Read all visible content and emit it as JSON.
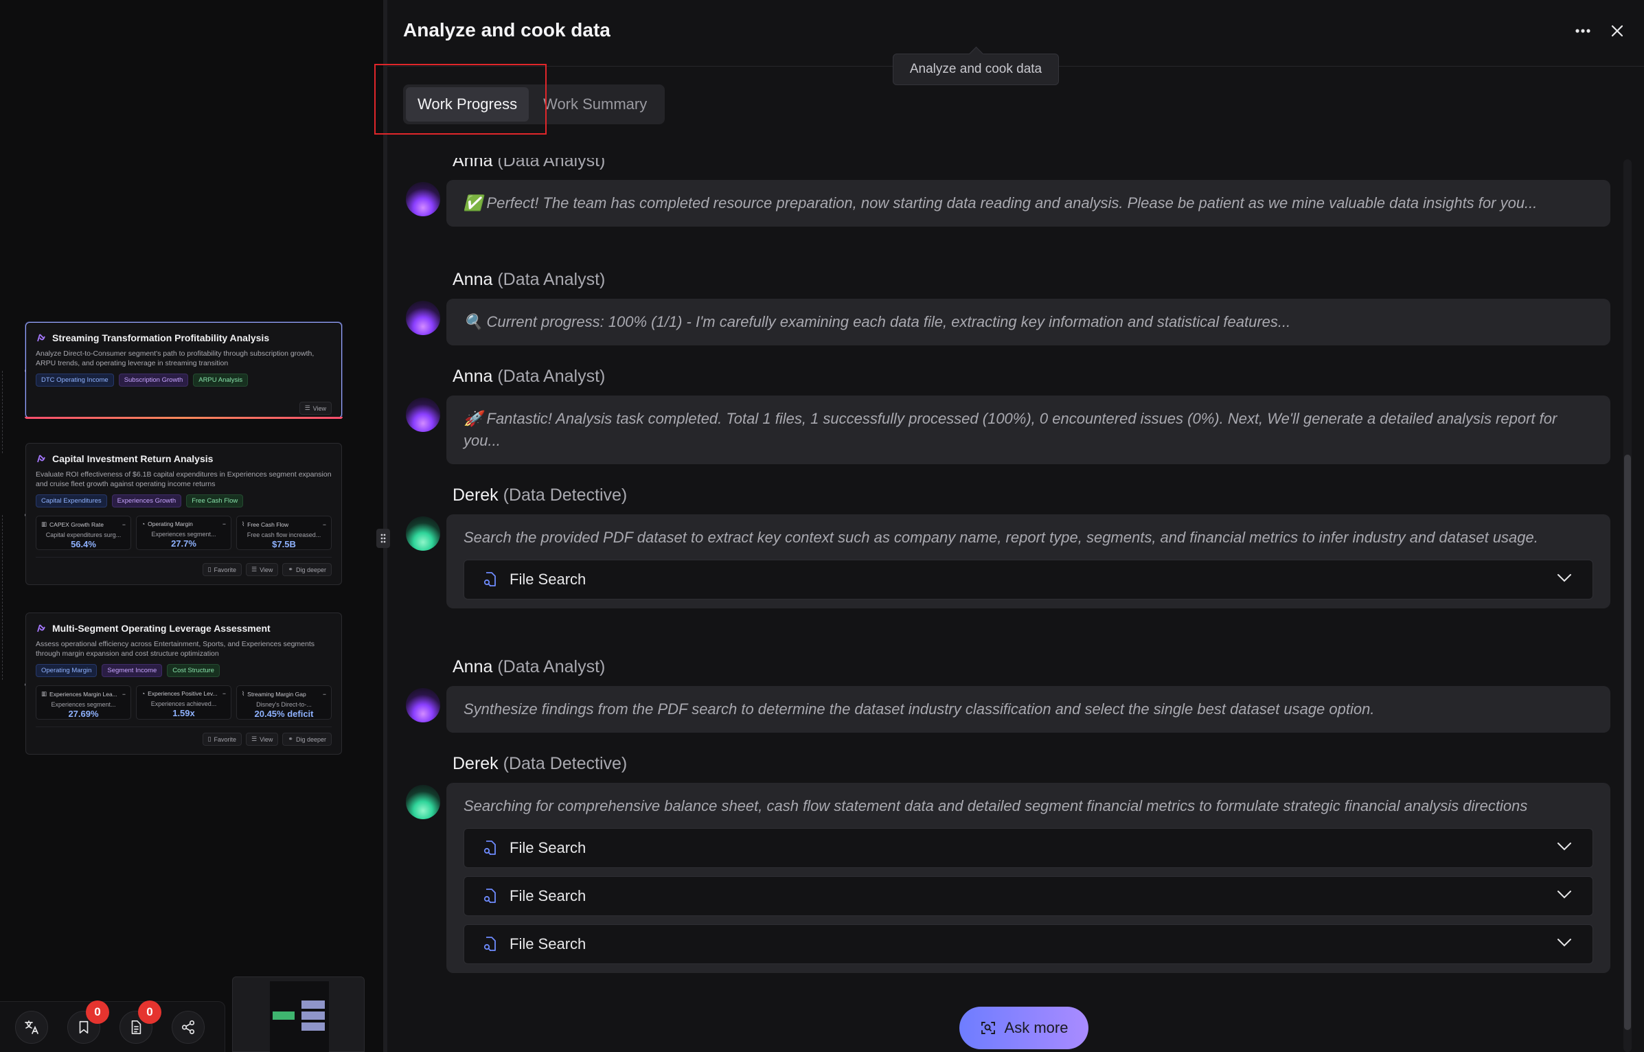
{
  "left_canvas": {
    "cards": [
      {
        "title": "Streaming Transformation Profitability Analysis",
        "desc": "Analyze Direct-to-Consumer segment's path to profitability through subscription growth, ARPU trends, and operating leverage in streaming transition",
        "tags": [
          "DTC Operating Income",
          "Subscription Growth",
          "ARPU Analysis"
        ],
        "actions": [
          "View"
        ]
      },
      {
        "title": "Capital Investment Return Analysis",
        "desc": "Evaluate ROI effectiveness of $6.1B capital expenditures in Experiences segment expansion and cruise fleet growth against operating income returns",
        "tags": [
          "Capital Expenditures",
          "Experiences Growth",
          "Free Cash Flow"
        ],
        "metrics": [
          {
            "name": "CAPEX Growth Rate",
            "sub": "Capital expenditures surg...",
            "value": "56.4%"
          },
          {
            "name": "Operating Margin",
            "sub": "Experiences segment...",
            "value": "27.7%"
          },
          {
            "name": "Free Cash Flow",
            "sub": "Free cash flow increased...",
            "value": "$7.5B"
          }
        ],
        "actions": [
          "Favorite",
          "View",
          "Dig deeper"
        ]
      },
      {
        "title": "Multi-Segment Operating Leverage Assessment",
        "desc": "Assess operational efficiency across Entertainment, Sports, and Experiences segments through margin expansion and cost structure optimization",
        "tags": [
          "Operating Margin",
          "Segment Income",
          "Cost Structure"
        ],
        "metrics": [
          {
            "name": "Experiences Margin Lea...",
            "sub": "Experiences segment...",
            "value": "27.69%"
          },
          {
            "name": "Experiences Positive Lev...",
            "sub": "Experiences achieved...",
            "value": "1.59x"
          },
          {
            "name": "Streaming Margin Gap",
            "sub": "Disney's Direct-to-...",
            "value": "20.45% deficit"
          }
        ],
        "actions": [
          "Favorite",
          "View",
          "Dig deeper"
        ]
      }
    ],
    "toolbar": {
      "bookmark_badge": "0",
      "doc_badge": "0"
    }
  },
  "panel": {
    "title": "Analyze and cook data",
    "tooltip": "Analyze and cook data",
    "tabs": [
      "Work Progress",
      "Work Summary"
    ],
    "active_tab": "Work Progress",
    "messages": [
      {
        "name": "Anna",
        "role": "(Data Analyst)",
        "text": "✅ Perfect! The team has completed resource preparation, now starting data reading and analysis. Please be patient as we mine valuable data insights for you..."
      },
      {
        "name": "Anna",
        "role": "(Data Analyst)",
        "text": "🔍 Current progress: 100% (1/1) - I'm carefully examining each data file, extracting key information and statistical features..."
      },
      {
        "name": "Anna",
        "role": "(Data Analyst)",
        "text": "🚀 Fantastic! Analysis task completed. Total 1 files, 1 successfully processed (100%), 0 encountered issues (0%). Next, We'll generate a detailed analysis report for you..."
      },
      {
        "name": "Derek",
        "role": "(Data Detective)",
        "text": "Search the provided PDF dataset to extract key context such as company name, report type, segments, and financial metrics to infer industry and dataset usage.",
        "tools": [
          "File Search"
        ]
      },
      {
        "name": "Anna",
        "role": "(Data Analyst)",
        "text": "Synthesize findings from the PDF search to determine the dataset industry classification and select the single best dataset usage option."
      },
      {
        "name": "Derek",
        "role": "(Data Detective)",
        "text": "Searching for comprehensive balance sheet, cash flow statement data and detailed segment financial metrics to formulate strategic financial analysis directions",
        "tools": [
          "File Search",
          "File Search",
          "File Search"
        ]
      }
    ],
    "ask_more_label": "Ask more"
  },
  "colors": {
    "accent_blue": "#8fb2ff",
    "highlight_red": "#e0262a",
    "badge_red": "#e5342f",
    "ask_gradient_start": "#6e7dff",
    "ask_gradient_end": "#a98bff"
  }
}
